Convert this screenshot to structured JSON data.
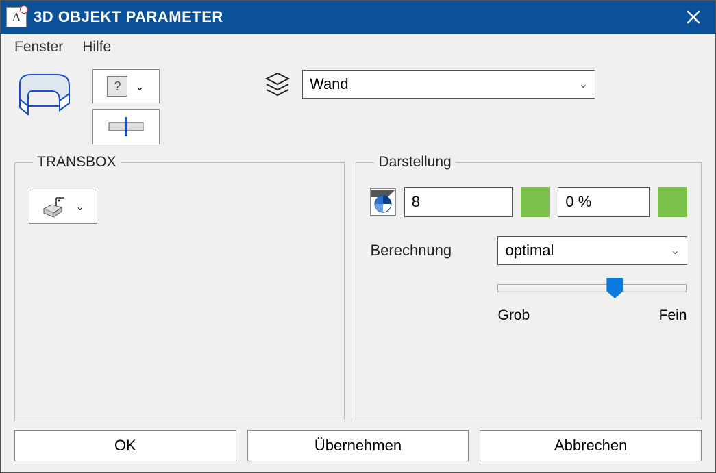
{
  "window": {
    "title": "3D OBJEKT PARAMETER"
  },
  "menu": {
    "window": "Fenster",
    "help": "Hilfe"
  },
  "layer": {
    "selected": "Wand"
  },
  "group": {
    "transbox": "TRANSBOX",
    "darstellung": "Darstellung"
  },
  "darstellung": {
    "value1": "8",
    "value2": "0 %",
    "color1": "#7cc24a",
    "color2": "#7cc24a",
    "calc_label": "Berechnung",
    "calc_value": "optimal",
    "slider_pos_percent": 62,
    "slider_min_label": "Grob",
    "slider_max_label": "Fein"
  },
  "buttons": {
    "ok": "OK",
    "apply": "Übernehmen",
    "cancel": "Abbrechen"
  }
}
